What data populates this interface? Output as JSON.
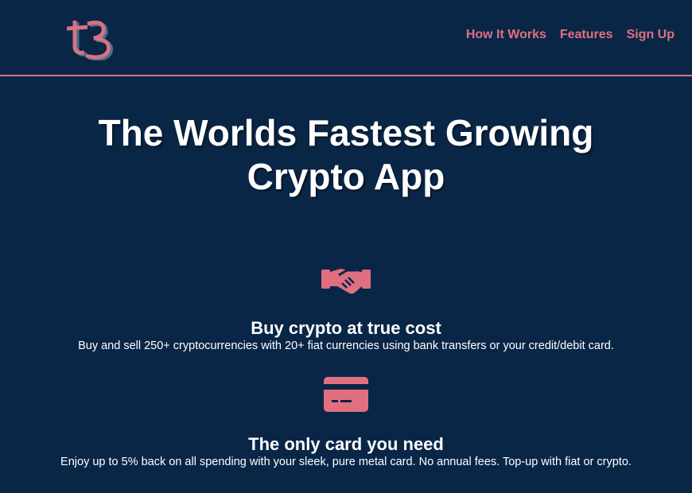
{
  "brand": {
    "logo_icon": "t3-logo",
    "accent": "#e06f80",
    "background": "#0a2647"
  },
  "nav": {
    "items": [
      {
        "label": "How It Works"
      },
      {
        "label": "Features"
      },
      {
        "label": "Sign Up"
      }
    ]
  },
  "hero": {
    "title_line1": "The Worlds Fastest Growing",
    "title_line2": "Crypto App"
  },
  "features": [
    {
      "icon": "handshake-icon",
      "title": "Buy crypto at true cost",
      "description": "Buy and sell 250+ cryptocurrencies with 20+ fiat currencies using bank transfers or your credit/debit card."
    },
    {
      "icon": "credit-card-icon",
      "title": "The only card you need",
      "description": "Enjoy up to 5% back on all spending with your sleek, pure metal card. No annual fees. Top-up with fiat or crypto."
    }
  ]
}
